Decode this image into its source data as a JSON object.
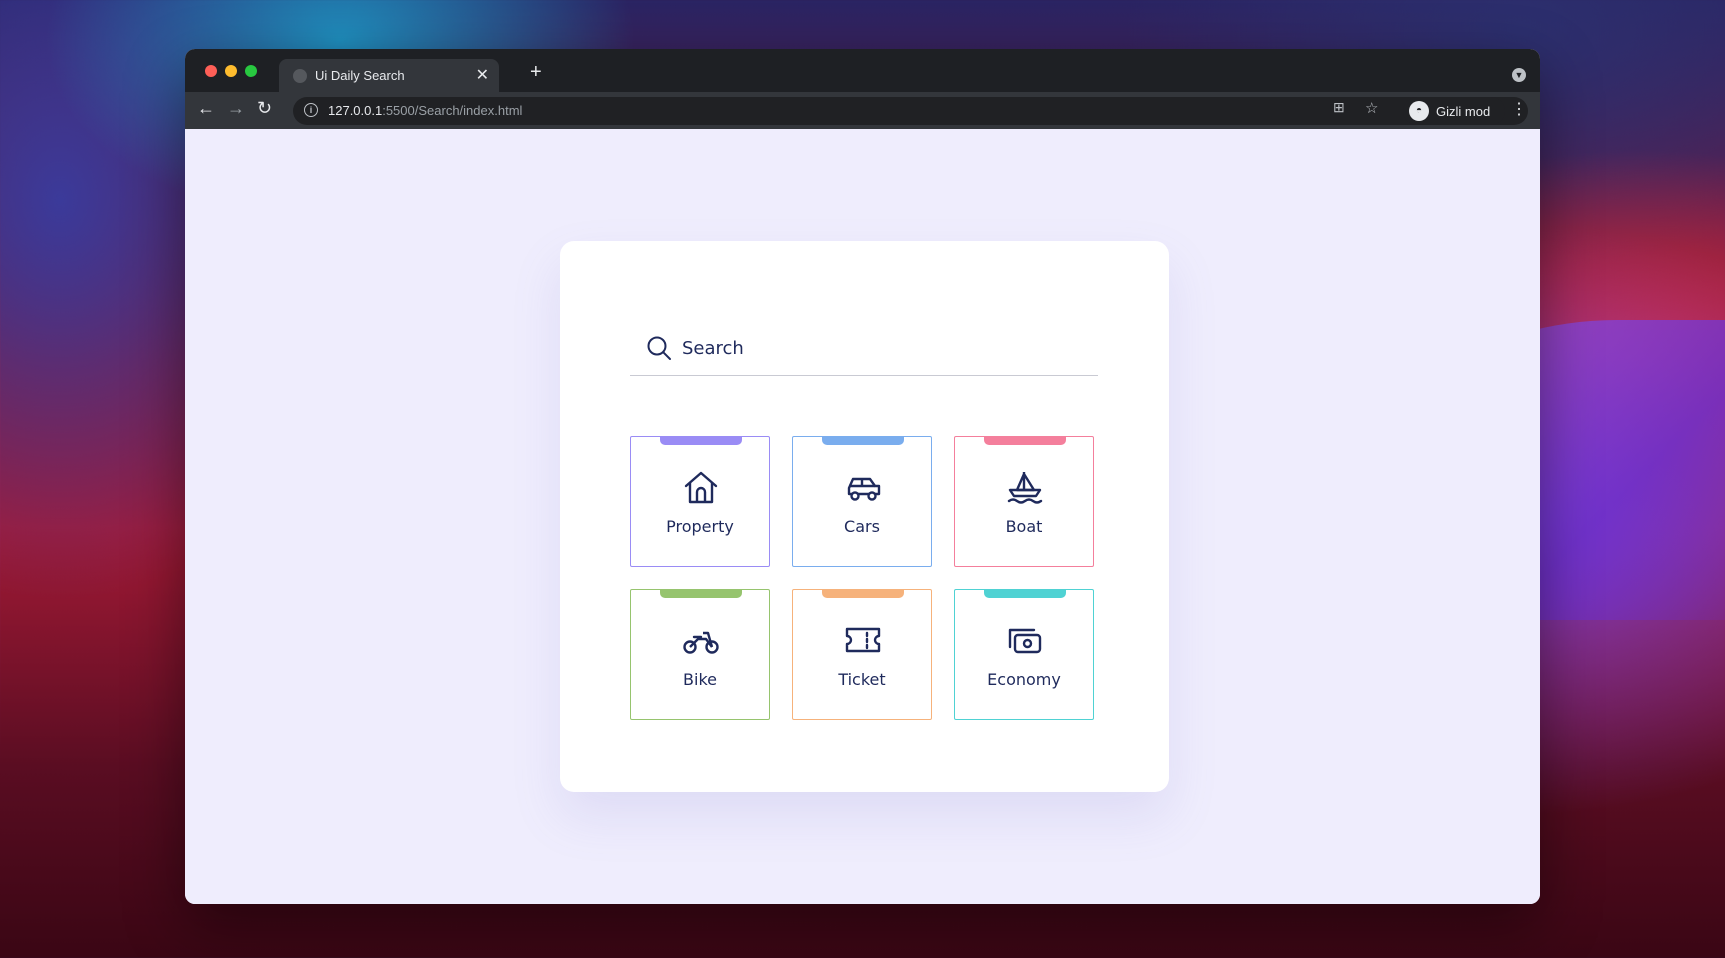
{
  "browser": {
    "tab_title": "Ui Daily Search",
    "url_host": "127.0.0.1",
    "url_rest": ":5500/Search/index.html",
    "profile_label": "Gizli mod"
  },
  "search": {
    "placeholder": "Search"
  },
  "categories": [
    {
      "label": "Property",
      "icon": "house-icon",
      "color": "#9a8cf5"
    },
    {
      "label": "Cars",
      "icon": "car-icon",
      "color": "#7aadee"
    },
    {
      "label": "Boat",
      "icon": "sailboat-icon",
      "color": "#f47f9c"
    },
    {
      "label": "Bike",
      "icon": "motorcycle-icon",
      "color": "#96c46e"
    },
    {
      "label": "Ticket",
      "icon": "ticket-icon",
      "color": "#f6b27b"
    },
    {
      "label": "Economy",
      "icon": "money-icon",
      "color": "#4fd2d3"
    }
  ]
}
